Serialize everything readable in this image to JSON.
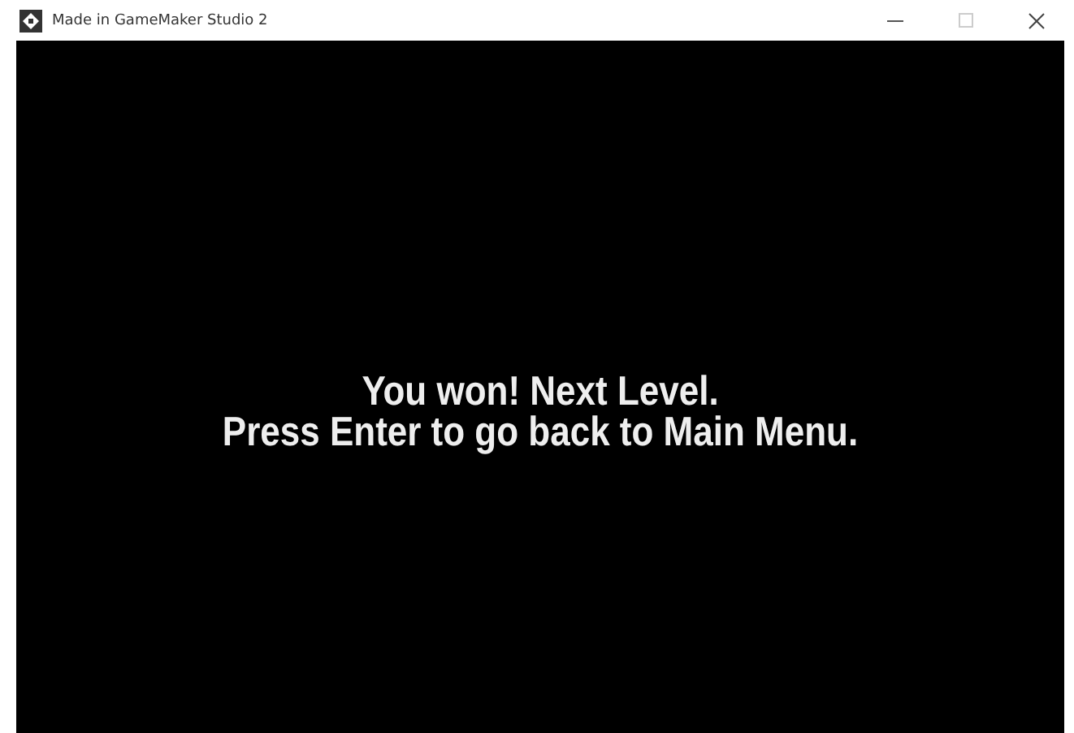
{
  "window": {
    "title": "Made in GameMaker Studio 2"
  },
  "game_screen": {
    "lines": [
      "You won! Next Level.",
      "Press Enter to go back to Main Menu."
    ]
  }
}
